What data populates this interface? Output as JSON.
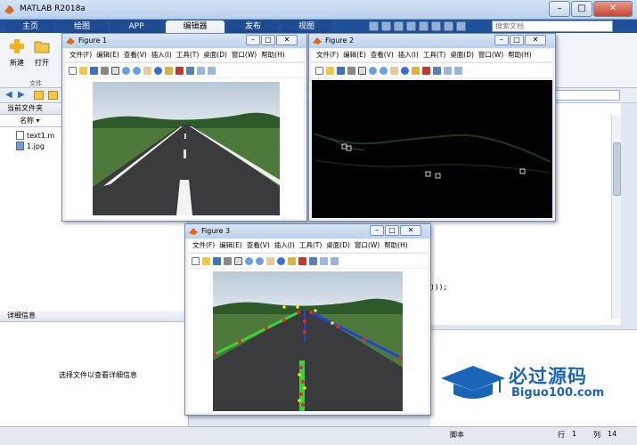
{
  "window": {
    "title": "MATLAB R2018a"
  },
  "ribbon_tabs": [
    "主页",
    "绘图",
    "APP",
    "编辑器",
    "发布",
    "视图"
  ],
  "search": {
    "placeholder": "搜索文档"
  },
  "ribbon": {
    "new_label": "新建",
    "open_label": "打开",
    "section_label": "文件"
  },
  "current_folder": {
    "header": "当前文件夹",
    "column_name": "名称",
    "files": [
      "text1.m",
      "1.jpg"
    ]
  },
  "details": {
    "header": "详细信息",
    "empty_text": "选择文件以查看详细信息"
  },
  "editor": {
    "code_fragment": ")));"
  },
  "statusbar": {
    "mode": "脚本",
    "row_label": "行",
    "row_value": "1",
    "col_label": "列",
    "col_value": "14"
  },
  "figure_menu": [
    "文件(F)",
    "编辑(E)",
    "查看(V)",
    "插入(I)",
    "工具(T)",
    "桌面(D)",
    "窗口(W)",
    "帮助(H)"
  ],
  "figures": [
    {
      "title": "Figure 1",
      "content": "road-photo"
    },
    {
      "title": "Figure 2",
      "content": "black-edge-image"
    },
    {
      "title": "Figure 3",
      "content": "road-with-detected-lanes"
    }
  ],
  "watermark": {
    "cn": "必过源码",
    "en": "Biguo100.com"
  },
  "colors": {
    "ribbon_blue": "#21509a",
    "lane_green": "#37d23c",
    "lane_blue": "#2244dd",
    "marker_red": "#e8261c",
    "marker_yellow": "#f5e21a"
  }
}
